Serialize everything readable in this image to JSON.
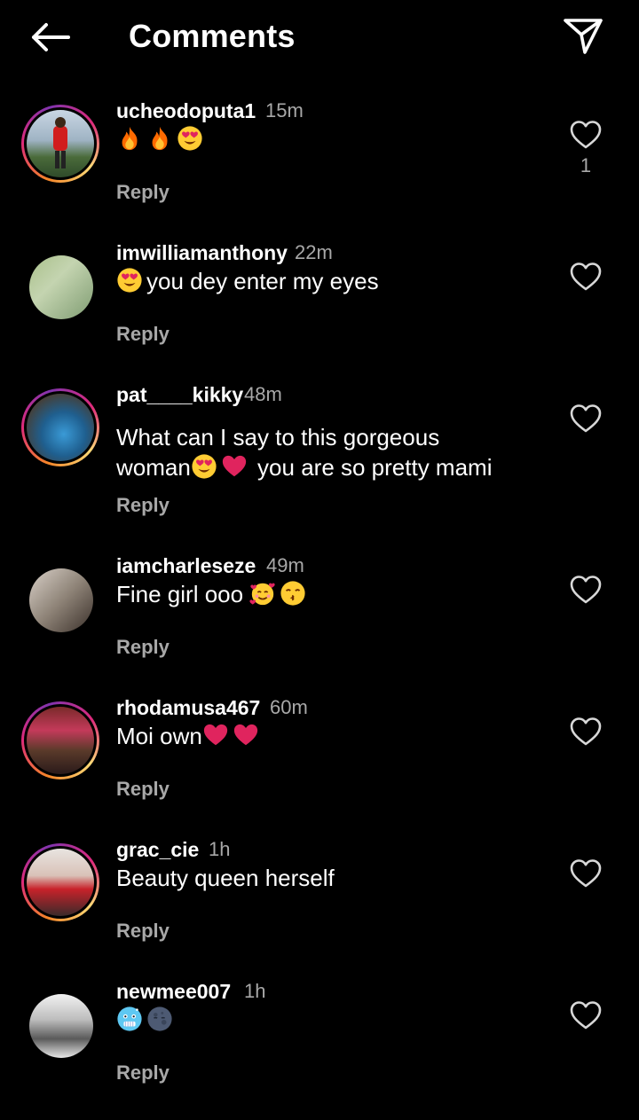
{
  "header": {
    "title": "Comments",
    "back_icon": "arrow-left-icon",
    "share_icon": "paper-plane-icon"
  },
  "colors": {
    "background": "#000000",
    "text": "#ffffff",
    "secondary_text": "#a8a8a8",
    "story_ring_start": "#f58529",
    "story_ring_end": "#8134af",
    "heart_emoji_red": "#e0245e",
    "fire_orange": "#ff6a00",
    "emoji_yellow": "#ffcc33"
  },
  "comments": [
    {
      "username": "ucheodoputa1",
      "time": "15m",
      "text": "",
      "emojis": [
        "fire",
        "fire",
        "heart-eyes"
      ],
      "reply": "Reply",
      "likes": "1"
    },
    {
      "username": "imwilliamanthony",
      "time": "22m",
      "text": "you dey enter my eyes",
      "emojis": [
        "heart-eyes"
      ],
      "reply": "Reply",
      "likes": ""
    },
    {
      "username": "pat____kikky",
      "time": "48m",
      "text_line1": "What can I say to this gorgeous",
      "text_line2_start": "woman",
      "text_line2_end": " you are so pretty mami",
      "emojis": [
        "heart-eyes",
        "red-heart"
      ],
      "reply": "Reply",
      "likes": ""
    },
    {
      "username": "iamcharleseze",
      "time": "49m",
      "text": "Fine girl ooo ",
      "emojis": [
        "smiling-face-with-hearts",
        "kissing-face"
      ],
      "reply": "Reply",
      "likes": ""
    },
    {
      "username": "rhodamusa467",
      "time": "60m",
      "text": "Moi own",
      "emojis": [
        "red-heart",
        "red-heart"
      ],
      "reply": "Reply",
      "likes": ""
    },
    {
      "username": "grac_cie",
      "time": "1h",
      "text": "Beauty queen herself",
      "emojis": [],
      "reply": "Reply",
      "likes": ""
    },
    {
      "username": "newmee007",
      "time": "1h",
      "text": "",
      "emojis": [
        "cold-face",
        "new-moon-face"
      ],
      "reply": "Reply",
      "likes": ""
    }
  ]
}
